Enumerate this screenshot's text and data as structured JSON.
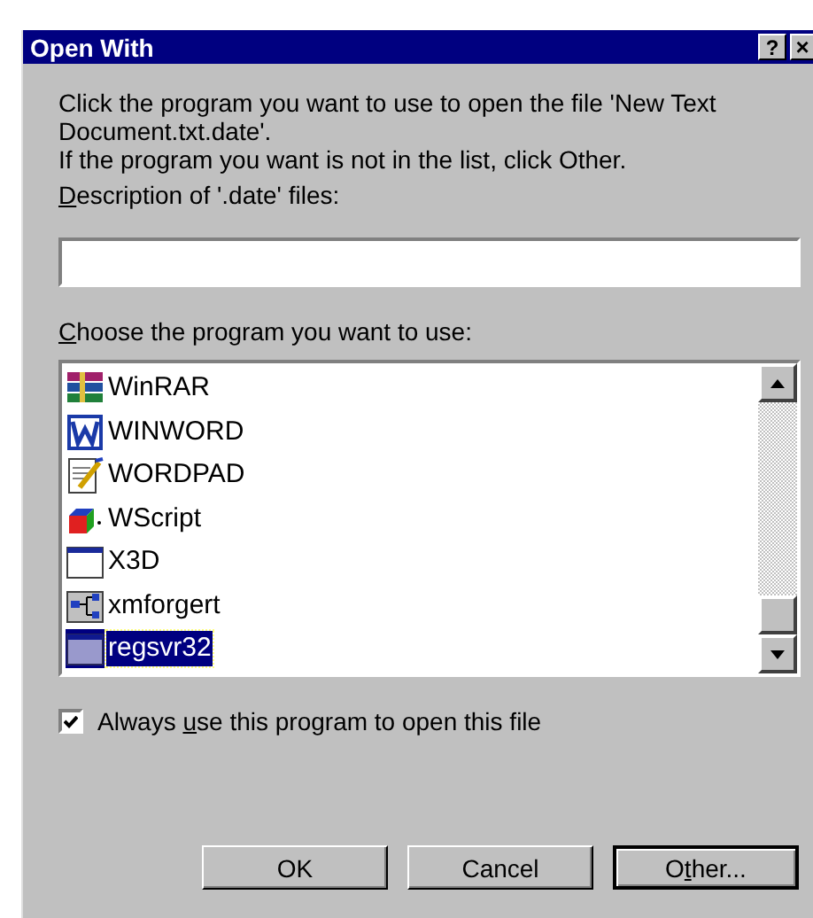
{
  "window": {
    "title": "Open With",
    "help_button": "?",
    "close_button": "×"
  },
  "intro": [
    "Click the program you want to use to open the file 'New Text Document.txt.date'.",
    "If the program you want is not in the list, click Other."
  ],
  "description": {
    "label": {
      "mnemonic": "D",
      "after": "escription of '.date' files:"
    }
  },
  "program_list": {
    "label": {
      "mnemonic": "C",
      "after": "hoose the program you want to use:"
    },
    "items": [
      {
        "name": "WinRAR",
        "kind": "archive",
        "selected": false
      },
      {
        "name": "WINWORD",
        "kind": "word",
        "selected": false
      },
      {
        "name": "WORDPAD",
        "kind": "notepad",
        "selected": false
      },
      {
        "name": "WScript",
        "kind": "script",
        "selected": false
      },
      {
        "name": "X3D",
        "kind": "window",
        "selected": false
      },
      {
        "name": "xmforgert",
        "kind": "tree",
        "selected": false
      },
      {
        "name": "regsvr32",
        "kind": "window",
        "selected": true
      }
    ]
  },
  "always_use": {
    "before": "Always ",
    "mnemonic": "u",
    "after": "se this program to open this file",
    "checked": true
  },
  "buttons": [
    {
      "before": "OK",
      "default": false
    },
    {
      "before": "Cancel",
      "default": false
    },
    {
      "before": "O",
      "mnemonic": "t",
      "after": "her...",
      "default": true
    }
  ]
}
